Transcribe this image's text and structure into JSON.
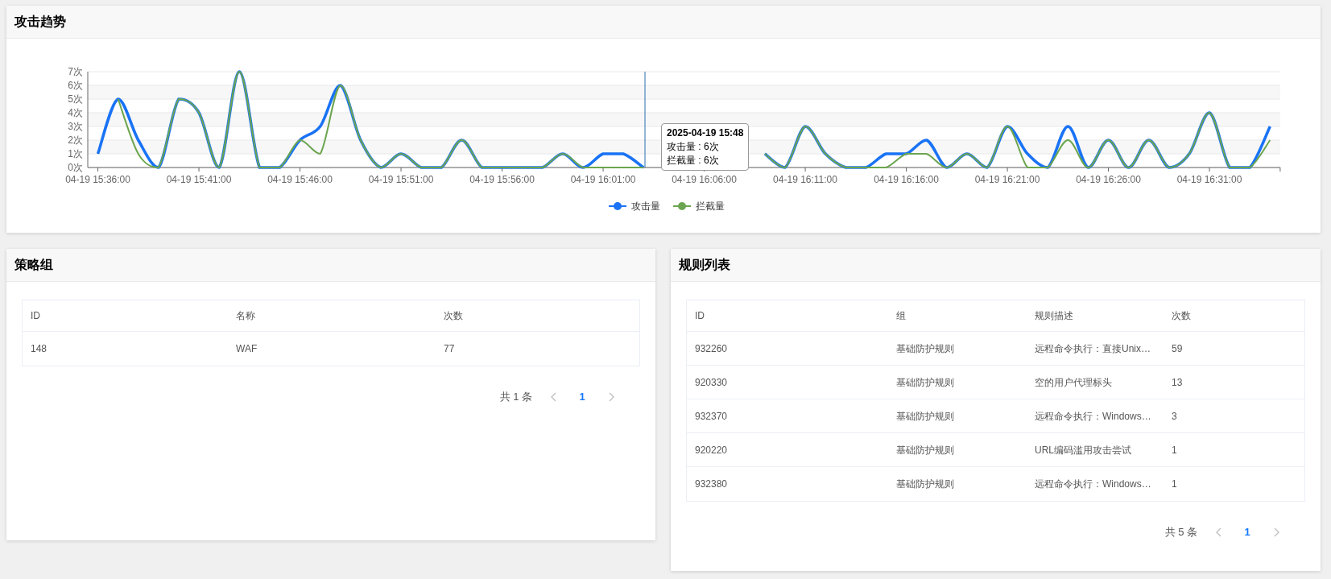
{
  "trend_card": {
    "title": "攻击趋势",
    "chart_data": {
      "type": "line",
      "categories": [
        "04-19 15:36:00",
        null,
        null,
        null,
        null,
        "04-19 15:41:00",
        null,
        null,
        null,
        null,
        "04-19 15:46:00",
        null,
        null,
        null,
        null,
        "04-19 15:51:00",
        null,
        null,
        null,
        null,
        "04-19 15:56:00",
        null,
        null,
        null,
        null,
        "04-19 16:01:00",
        null,
        null,
        null,
        null,
        "04-19 16:06:00",
        null,
        null,
        null,
        null,
        "04-19 16:11:00",
        null,
        null,
        null,
        null,
        "04-19 16:16:00",
        null,
        null,
        null,
        null,
        "04-19 16:21:00",
        null,
        null,
        null,
        null,
        "04-19 16:26:00",
        null,
        null,
        null,
        null,
        "04-19 16:31:00",
        null,
        null,
        null
      ],
      "series": [
        {
          "name": "攻击量",
          "color": "#1a73f5",
          "values": [
            1,
            5,
            2,
            0,
            5,
            4,
            0,
            7,
            0,
            0,
            2,
            3,
            6,
            2,
            0,
            1,
            0,
            0,
            2,
            0,
            0,
            0,
            0,
            1,
            0,
            1,
            1,
            0,
            null,
            null,
            null,
            null,
            null,
            1,
            0,
            3,
            1,
            0,
            0,
            1,
            1,
            2,
            0,
            1,
            0,
            3,
            1,
            0,
            3,
            0,
            2,
            0,
            2,
            0,
            1,
            4,
            0,
            0,
            3
          ]
        },
        {
          "name": "拦截量",
          "color": "#6ba54f",
          "values": [
            null,
            5,
            1,
            0,
            5,
            4,
            0,
            7,
            0,
            0,
            2,
            1,
            6,
            2,
            0,
            1,
            0,
            0,
            2,
            0,
            0,
            0,
            0,
            1,
            0,
            0,
            0,
            0,
            null,
            null,
            null,
            null,
            null,
            1,
            0,
            3,
            1,
            0,
            0,
            0,
            1,
            1,
            0,
            1,
            0,
            3,
            0,
            0,
            2,
            0,
            2,
            0,
            2,
            0,
            1,
            4,
            0,
            0,
            2
          ]
        }
      ],
      "ylim": [
        0,
        7
      ],
      "grid": true,
      "legend": "bottom",
      "yticks": [
        {
          "value": 0,
          "label": "0次"
        },
        {
          "value": 1,
          "label": "1次"
        },
        {
          "value": 2,
          "label": "2次"
        },
        {
          "value": 3,
          "label": "3次"
        },
        {
          "value": 4,
          "label": "4次"
        },
        {
          "value": 5,
          "label": "5次"
        },
        {
          "value": 6,
          "label": "6次"
        },
        {
          "value": 7,
          "label": "7次"
        }
      ]
    },
    "tooltip": {
      "title": "2025-04-19 15:48",
      "lines": [
        "攻击量 : 6次",
        "拦截量 : 6次"
      ]
    }
  },
  "policy_card": {
    "title": "策略组",
    "columns": [
      "ID",
      "名称",
      "次数"
    ],
    "rows": [
      [
        "148",
        "WAF",
        "77"
      ]
    ],
    "pagination": {
      "total": "共 1 条",
      "prev_disabled": true,
      "next_disabled": true,
      "pages": [
        {
          "label": "1",
          "selected": true
        }
      ]
    }
  },
  "rules_card": {
    "title": "规则列表",
    "columns": [
      "ID",
      "组",
      "规则描述",
      "次数"
    ],
    "rows": [
      [
        "932260",
        "基础防护规则",
        "远程命令执行：直接Unix…",
        "59"
      ],
      [
        "920330",
        "基础防护规则",
        "空的用户代理标头",
        "13"
      ],
      [
        "932370",
        "基础防护规则",
        "远程命令执行：Windows…",
        "3"
      ],
      [
        "920220",
        "基础防护规则",
        "URL编码滥用攻击尝试",
        "1"
      ],
      [
        "932380",
        "基础防护规则",
        "远程命令执行：Windows…",
        "1"
      ]
    ],
    "pagination": {
      "total": "共 5 条",
      "prev_disabled": true,
      "next_disabled": true,
      "pages": [
        {
          "label": "1",
          "selected": true
        }
      ]
    }
  }
}
